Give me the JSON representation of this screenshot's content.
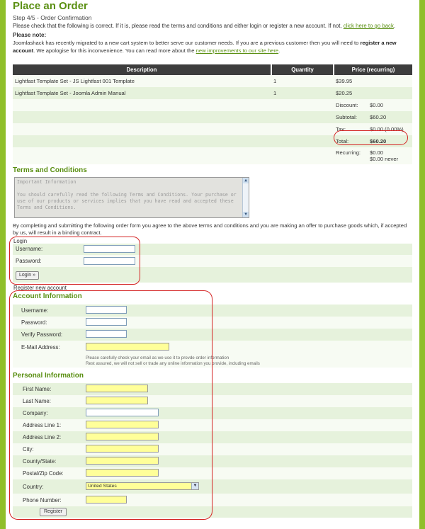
{
  "title": "Place an Order",
  "step": "Step 4/5 - Order Confirmation",
  "intro": {
    "text": "Please check that the following is correct. If it is, please read the terms and conditions and either login or register a new account. If not,",
    "link": "click here to go back",
    "end": "."
  },
  "note": {
    "title": "Please note:",
    "text1": "Joomlashack has recently migrated to a new cart system to better serve our customer needs. If you are a previous customer then you will need to",
    "bold": "register a new account",
    "text2": ". We apologise for this inconvenience. You can read more about the",
    "link": "new improvements to our site here",
    "end": "."
  },
  "order_table": {
    "headers": [
      "Description",
      "Quantity",
      "Price (recurring)"
    ],
    "items": [
      {
        "description": "Lightfast Template Set - JS Lightfast 001 Template",
        "quantity": "1",
        "price": "$39.95"
      },
      {
        "description": "Lightfast Template Set - Joomla Admin Manual",
        "quantity": "1",
        "price": "$20.25"
      }
    ],
    "summary": [
      {
        "label": "Discount:",
        "value": "$0.00"
      },
      {
        "label": "Subtotal:",
        "value": "$60.20"
      },
      {
        "label": "Tax:",
        "value": "$0.00 (0.00%)"
      },
      {
        "label": "Total:",
        "value": "$60.20"
      },
      {
        "label": "Recurring:",
        "value": "$0.00",
        "value2": "$0.00 never"
      }
    ]
  },
  "terms": {
    "heading": "Terms and Conditions",
    "box_title": "Important Information",
    "box_text": "You should carefully read the following Terms and Conditions. Your purchase or use of our products or services implies that you have read and accepted these Terms and Conditions.",
    "agreement": "By completing and submitting the following order form you agree to the above terms and conditions and you are making an offer to purchase goods which, if accepted by us, will result in a binding contract."
  },
  "login": {
    "legend": "Login",
    "username_label": "Username:",
    "password_label": "Password:",
    "button": "Login »"
  },
  "register_legend": "Register new account",
  "account": {
    "heading": "Account Information",
    "username_label": "Username:",
    "password_label": "Password:",
    "verify_label": "Verify Password:",
    "email_label": "E-Mail Address:",
    "hint1": "Please carefully check your email as we use it to provde order information",
    "hint2": "Rest assured, we will not sell or trade any online information you provide, including emails"
  },
  "personal": {
    "heading": "Personal Information",
    "fields": [
      "First Name:",
      "Last Name:",
      "Company:",
      "Address Line 1:",
      "Address Line 2:",
      "City:",
      "County/State:",
      "Postal/Zip Code:",
      "Country:",
      "Phone Number:"
    ],
    "country_value": "United States",
    "register_button": "Register"
  },
  "colors": {
    "accent": "#5a8f12",
    "background": "#8fbf2a",
    "annotation": "#d42323",
    "required_field": "#ffff99"
  }
}
